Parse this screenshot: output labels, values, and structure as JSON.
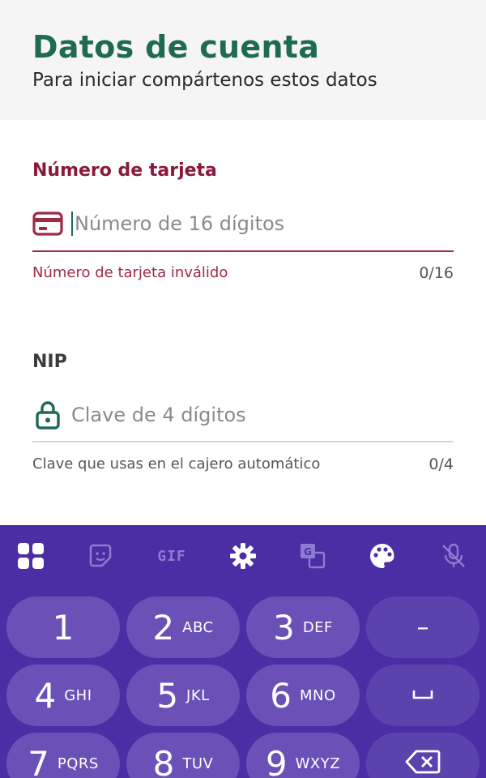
{
  "header": {
    "title": "Datos de cuenta",
    "subtitle": "Para iniciar compártenos estos datos"
  },
  "card_field": {
    "label": "Número de tarjeta",
    "placeholder": "Número de 16 dígitos",
    "value": "",
    "error": "Número de tarjeta inválido",
    "counter": "0/16",
    "icon": "credit-card-icon",
    "accent_color": "#a02a45"
  },
  "nip_field": {
    "label": "NIP",
    "placeholder": "Clave de 4 dígitos",
    "value": "",
    "helper": "Clave que usas en el cajero automático",
    "counter": "0/4",
    "icon": "lock-icon"
  },
  "keyboard": {
    "toolbar": [
      "apps-grid-icon",
      "sticker-icon",
      "gif-icon",
      "settings-icon",
      "translate-icon",
      "palette-icon",
      "mic-off-icon"
    ],
    "gif_label": "GIF",
    "keys": [
      {
        "digit": "1",
        "letters": ""
      },
      {
        "digit": "2",
        "letters": "ABC"
      },
      {
        "digit": "3",
        "letters": "DEF"
      },
      {
        "digit": "4",
        "letters": "GHI"
      },
      {
        "digit": "5",
        "letters": "JKL"
      },
      {
        "digit": "6",
        "letters": "MNO"
      },
      {
        "digit": "7",
        "letters": "PQRS"
      },
      {
        "digit": "8",
        "letters": "TUV"
      },
      {
        "digit": "9",
        "letters": "WXYZ"
      }
    ],
    "fn_keys": {
      "minus": "–",
      "space": "space-icon",
      "backspace": "backspace-icon"
    },
    "colors": {
      "background": "#4b2ea3",
      "key": "#6a50b7"
    }
  },
  "colors": {
    "brand_green": "#1e6b50",
    "error": "#a02a45"
  }
}
